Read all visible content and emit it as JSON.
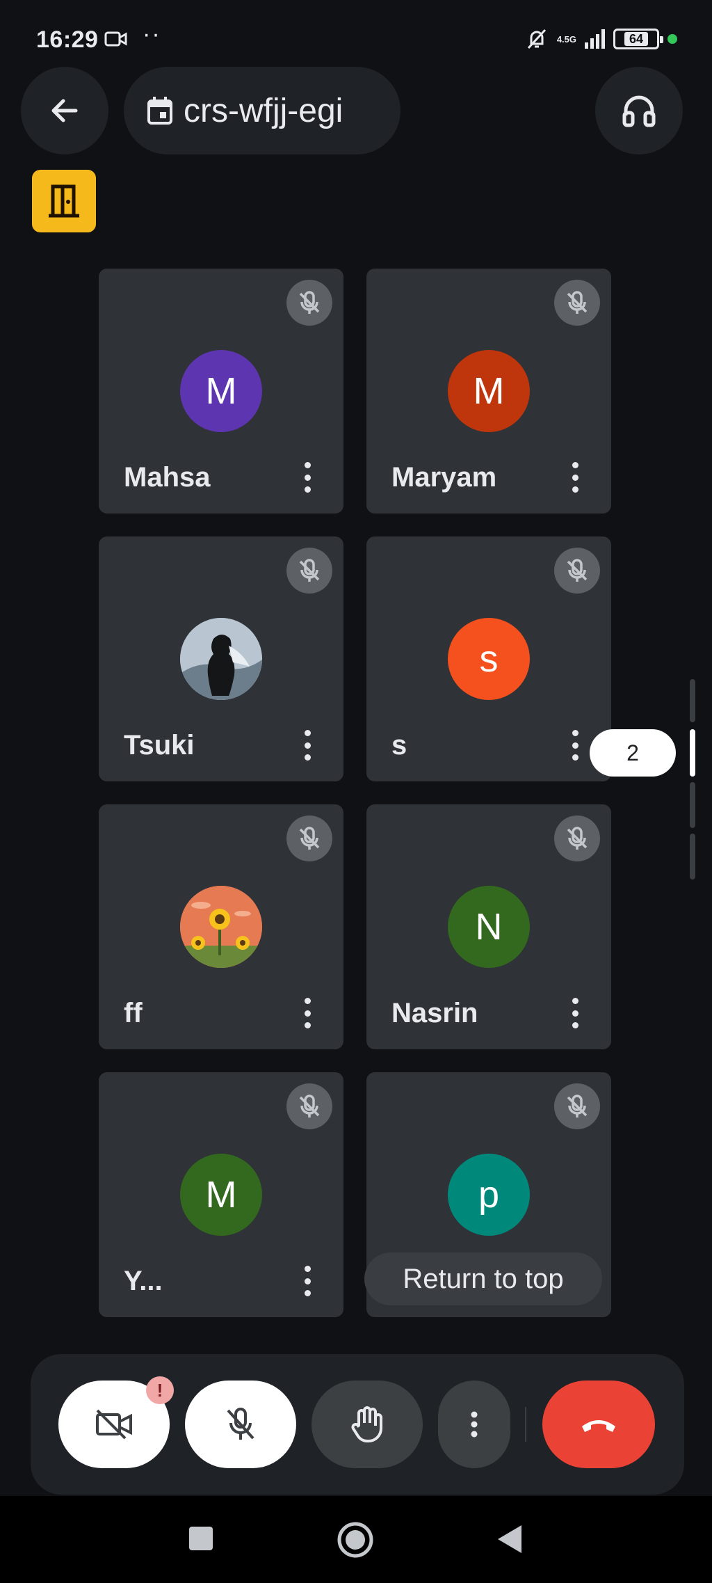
{
  "status_bar": {
    "time": "16:29",
    "dots": "··",
    "network": "4.5G",
    "battery": "64"
  },
  "header": {
    "meeting_code": "crs-wfjj-egi",
    "icons": {
      "back": "arrow-left-icon",
      "meeting": "calendar-icon",
      "audio": "headphones-icon",
      "exit": "door-icon"
    }
  },
  "participants": [
    {
      "name": "Mahsa",
      "initial": "M",
      "avatar_color": "#5e35b1",
      "avatar_type": "initial"
    },
    {
      "name": "Maryam",
      "initial": "M",
      "avatar_color": "#c0360c",
      "avatar_type": "initial"
    },
    {
      "name": "Tsuki",
      "initial": "",
      "avatar_color": "#8fa3b3",
      "avatar_type": "photo-silhouette"
    },
    {
      "name": "s",
      "initial": "s",
      "avatar_color": "#f4511e",
      "avatar_type": "initial"
    },
    {
      "name": "ff",
      "initial": "",
      "avatar_color": "#e6794f",
      "avatar_type": "photo-sunflowers"
    },
    {
      "name": "Nasrin",
      "initial": "N",
      "avatar_color": "#33691e",
      "avatar_type": "initial"
    },
    {
      "name": "Y...",
      "initial": "M",
      "avatar_color": "#33691e",
      "avatar_type": "initial"
    },
    {
      "name": "",
      "initial": "p",
      "avatar_color": "#00897b",
      "avatar_type": "initial"
    }
  ],
  "pagination": {
    "current_page": "2",
    "return_label": "Return to top"
  },
  "controls": {
    "camera": "camera-off-icon",
    "camera_alert": "!",
    "mic": "mic-off-icon",
    "hand": "raise-hand-icon",
    "more": "more-vert-icon",
    "end_call": "end-call-icon"
  },
  "colors": {
    "background": "#0f1115",
    "tile": "#2f3237",
    "end_call": "#ea4335",
    "exit_badge": "#f6b91b"
  }
}
